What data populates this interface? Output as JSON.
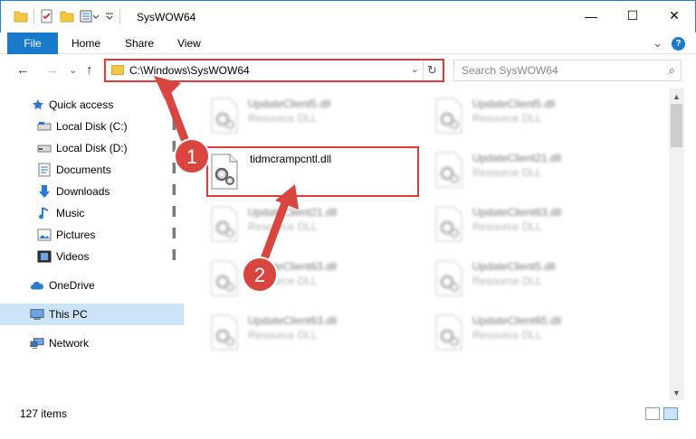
{
  "window": {
    "title": "SysWOW64",
    "minimize": "—",
    "maximize": "☐",
    "close": "✕"
  },
  "ribbon": {
    "file": "File",
    "home": "Home",
    "share": "Share",
    "view": "View",
    "expand": "⌄",
    "help": "?"
  },
  "nav": {
    "back": "←",
    "forward": "→",
    "recent": "⌄",
    "up": "↑",
    "address": "C:\\Windows\\SysWOW64",
    "address_dropdown": "⌄",
    "refresh": "↻",
    "search_placeholder": "Search SysWOW64",
    "search_icon": "⌕"
  },
  "sidebar": {
    "items": [
      {
        "label": "Quick access",
        "icon": "star-icon"
      },
      {
        "label": "Local Disk (C:)",
        "icon": "drive-icon",
        "pinned": true
      },
      {
        "label": "Local Disk (D:)",
        "icon": "drive-icon",
        "pinned": true
      },
      {
        "label": "Documents",
        "icon": "documents-icon",
        "pinned": true
      },
      {
        "label": "Downloads",
        "icon": "downloads-icon",
        "pinned": true
      },
      {
        "label": "Music",
        "icon": "music-icon",
        "pinned": true
      },
      {
        "label": "Pictures",
        "icon": "pictures-icon",
        "pinned": true
      },
      {
        "label": "Videos",
        "icon": "videos-icon",
        "pinned": true
      },
      {
        "label": "OneDrive",
        "icon": "cloud-icon"
      },
      {
        "label": "This PC",
        "icon": "computer-icon",
        "selected": true
      },
      {
        "label": "Network",
        "icon": "network-icon"
      }
    ],
    "pin_glyph": "📌"
  },
  "files": [
    {
      "name": "UpdateClient5.dll",
      "type": "Resource DLL",
      "blurred": true
    },
    {
      "name": "UpdateClient5.dll",
      "type": "Resource DLL",
      "blurred": true
    },
    {
      "name": "tidmcrampcntl.dll",
      "type": "",
      "blurred": false
    },
    {
      "name": "UpdateClient21.dll",
      "type": "Resource DLL",
      "blurred": true
    },
    {
      "name": "UpdateClient21.dll",
      "type": "Resource DLL",
      "blurred": true
    },
    {
      "name": "UpdateClient63.dll",
      "type": "Resource DLL",
      "blurred": true
    },
    {
      "name": "UpdateClient63.dll",
      "type": "Resource DLL",
      "blurred": true
    },
    {
      "name": "UpdateClient5.dll",
      "type": "Resource DLL",
      "blurred": true
    },
    {
      "name": "UpdateClient63.dll",
      "type": "Resource DLL",
      "blurred": true
    },
    {
      "name": "UpdateClient65.dll",
      "type": "Resource DLL",
      "blurred": true
    }
  ],
  "status": {
    "count": "127 items"
  },
  "callouts": {
    "step1": "1",
    "step2": "2"
  },
  "colors": {
    "accent": "#1979ca",
    "highlight": "#e23a3a",
    "selected_bg": "#cce4f7"
  }
}
